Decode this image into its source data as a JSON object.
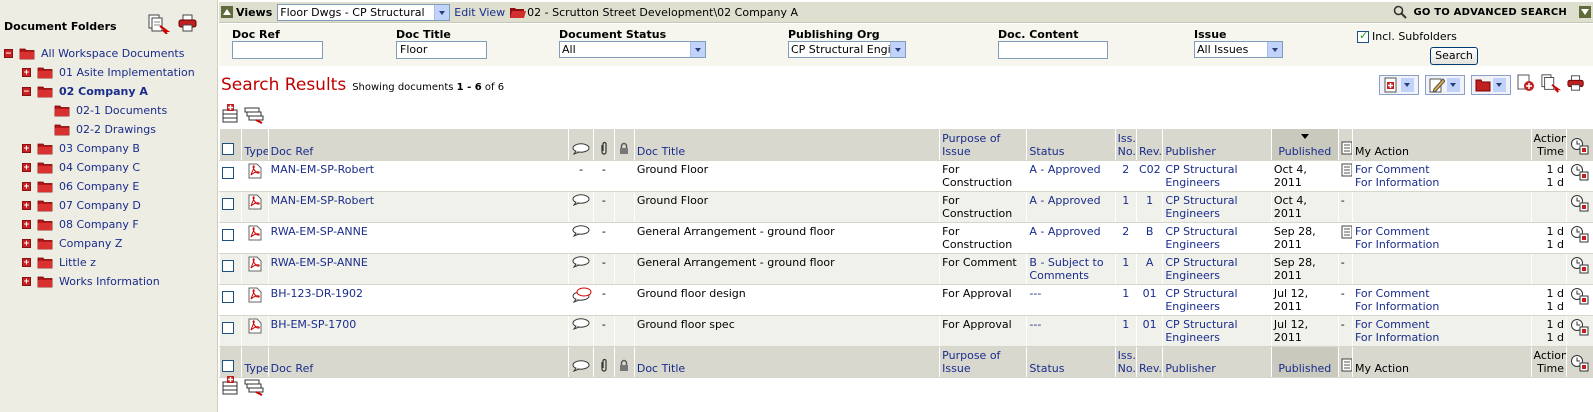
{
  "sidebar": {
    "title": "Document Folders",
    "tree": [
      {
        "label": "All Workspace Documents",
        "toggle": "−",
        "level": 0,
        "selected": false
      },
      {
        "label": "01 Asite Implementation",
        "toggle": "+",
        "level": 1,
        "selected": false
      },
      {
        "label": "02 Company A",
        "toggle": "−",
        "level": 1,
        "selected": true
      },
      {
        "label": "02-1 Documents",
        "toggle": "",
        "level": 2,
        "selected": false
      },
      {
        "label": "02-2 Drawings",
        "toggle": "",
        "level": 2,
        "selected": false
      },
      {
        "label": "03 Company B",
        "toggle": "+",
        "level": 1,
        "selected": false
      },
      {
        "label": "04 Company C",
        "toggle": "+",
        "level": 1,
        "selected": false
      },
      {
        "label": "06 Company E",
        "toggle": "+",
        "level": 1,
        "selected": false
      },
      {
        "label": "07 Company D",
        "toggle": "+",
        "level": 1,
        "selected": false
      },
      {
        "label": "08 Company F",
        "toggle": "+",
        "level": 1,
        "selected": false
      },
      {
        "label": "Company Z",
        "toggle": "+",
        "level": 1,
        "selected": false
      },
      {
        "label": "Little z",
        "toggle": "+",
        "level": 1,
        "selected": false
      },
      {
        "label": "Works Information",
        "toggle": "+",
        "level": 1,
        "selected": false
      }
    ]
  },
  "topbar": {
    "views_label": "Views",
    "views_value": "Floor Dwgs - CP Structural",
    "edit_view": "Edit View",
    "path": "02 - Scrutton Street Development\\02 Company A",
    "advanced_search": "GO TO ADVANCED SEARCH"
  },
  "filters": {
    "doc_ref": {
      "label": "Doc Ref",
      "value": ""
    },
    "doc_title": {
      "label": "Doc Title",
      "value": "Floor"
    },
    "doc_status": {
      "label": "Document Status",
      "value": "All"
    },
    "publishing_org": {
      "label": "Publishing Org",
      "value": "CP Structural Engine"
    },
    "doc_content": {
      "label": "Doc. Content",
      "value": ""
    },
    "issue": {
      "label": "Issue",
      "value": "All Issues"
    },
    "incl_subfolders": {
      "label": "Incl. Subfolders",
      "checked": true
    },
    "search_button": "Search"
  },
  "results": {
    "title": "Search Results",
    "showing_prefix": "Showing documents ",
    "showing_range": "1 - 6",
    "showing_suffix": " of 6"
  },
  "columns": {
    "type": "Type",
    "doc_ref": "Doc Ref",
    "doc_title": "Doc Title",
    "purpose": "Purpose of Issue",
    "status": "Status",
    "iss_no": "Iss. No.",
    "rev": "Rev.",
    "publisher": "Publisher",
    "published": "Published",
    "my_action": "My Action",
    "action_time": "Action Time"
  },
  "rows": [
    {
      "doc_ref": "MAN-EM-SP-Robert",
      "comment": "-",
      "attach": "-",
      "title": "Ground Floor",
      "purpose": "For Construction",
      "status": "A - Approved",
      "iss": "2",
      "rev": "C02",
      "publisher": "CP Structural Engineers",
      "published": "Oct 4, 2011",
      "has_note": true,
      "actions": [
        "For Comment",
        "For Information"
      ],
      "times": [
        "1 d",
        "1 d"
      ]
    },
    {
      "doc_ref": "MAN-EM-SP-Robert",
      "comment": "bubble",
      "attach": "-",
      "title": "Ground Floor",
      "purpose": "For Construction",
      "status": "A - Approved",
      "iss": "1",
      "rev": "1",
      "publisher": "CP Structural Engineers",
      "published": "Oct 4, 2011",
      "has_note": false,
      "actions": [],
      "times": []
    },
    {
      "doc_ref": "RWA-EM-SP-ANNE",
      "comment": "bubble",
      "attach": "-",
      "title": "General Arrangement - ground floor",
      "purpose": "For Construction",
      "status": "A - Approved",
      "iss": "2",
      "rev": "B",
      "publisher": "CP Structural Engineers",
      "published": "Sep 28, 2011",
      "has_note": true,
      "actions": [
        "For Comment",
        "For Information"
      ],
      "times": [
        "1 d",
        "1 d"
      ]
    },
    {
      "doc_ref": "RWA-EM-SP-ANNE",
      "comment": "bubble",
      "attach": "-",
      "title": "General Arrangement - ground floor",
      "purpose": "For Comment",
      "status": "B - Subject to Comments",
      "iss": "1",
      "rev": "A",
      "publisher": "CP Structural Engineers",
      "published": "Sep 28, 2011",
      "has_note": false,
      "actions": [],
      "times": []
    },
    {
      "doc_ref": "BH-123-DR-1902",
      "comment": "bubble-red",
      "attach": "-",
      "title": "Ground floor design",
      "purpose": "For Approval",
      "status": "---",
      "iss": "1",
      "rev": "01",
      "publisher": "CP Structural Engineers",
      "published": "Jul 12, 2011",
      "has_note": false,
      "actions": [
        "For Comment",
        "For Information"
      ],
      "times": [
        "1 d",
        "1 d"
      ]
    },
    {
      "doc_ref": "BH-EM-SP-1700",
      "comment": "bubble",
      "attach": "-",
      "title": "Ground floor spec",
      "purpose": "For Approval",
      "status": "---",
      "iss": "1",
      "rev": "01",
      "publisher": "CP Structural Engineers",
      "published": "Jul 12, 2011",
      "has_note": false,
      "actions": [
        "For Comment",
        "For Information"
      ],
      "times": [
        "1 d",
        "1 d"
      ]
    }
  ],
  "colors": {
    "accent_red": "#c00000",
    "link_blue": "#1a2c8c",
    "header_bg": "#d8d8ce",
    "sidebar_bg": "#eeede3"
  }
}
